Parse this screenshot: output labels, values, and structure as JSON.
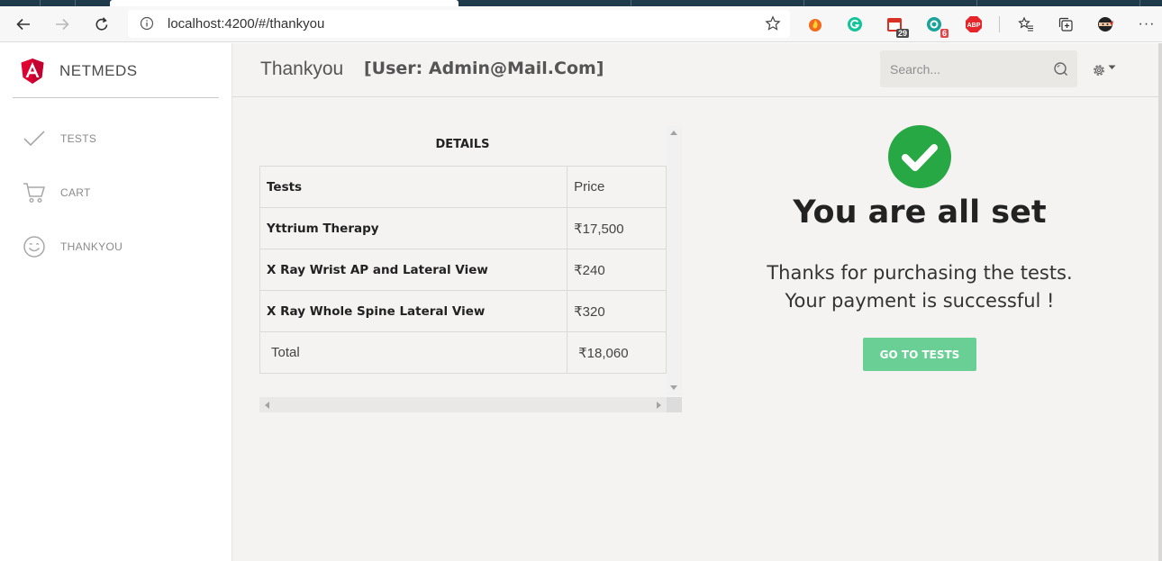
{
  "browser": {
    "url": "localhost:4200/#/thankyou",
    "extensions": [
      {
        "icon": "fire-extension-icon"
      },
      {
        "icon": "grammarly-extension-icon"
      },
      {
        "icon": "calendar-extension-icon",
        "badge": "29"
      },
      {
        "icon": "green-extension-icon",
        "badge": "6"
      },
      {
        "icon": "adblock-plus-extension-icon",
        "label": "ABP"
      },
      {
        "icon": "favorites-icon"
      },
      {
        "icon": "collections-icon"
      },
      {
        "icon": "ninja-extension-icon"
      },
      {
        "icon": "more-options-icon",
        "label": "···"
      }
    ]
  },
  "sidebar": {
    "brand": "NETMEDS",
    "items": [
      {
        "label": "TESTS",
        "icon": "check-icon"
      },
      {
        "label": "CART",
        "icon": "cart-icon"
      },
      {
        "label": "THANKYOU",
        "icon": "smiley-icon"
      }
    ]
  },
  "header": {
    "title": "Thankyou",
    "user": "[User: Admin@Mail.Com]",
    "search_placeholder": "Search...",
    "settings_icon": "gear-icon"
  },
  "details": {
    "title": "DETAILS",
    "col_tests": "Tests",
    "col_price": "Price",
    "rows": [
      {
        "name": "Yttrium Therapy",
        "price": "₹17,500"
      },
      {
        "name": "X Ray Wrist AP and Lateral View",
        "price": "₹240"
      },
      {
        "name": "X Ray Whole Spine Lateral View",
        "price": "₹320"
      }
    ],
    "total_label": "Total",
    "total_value": "₹18,060"
  },
  "success": {
    "title": "You are all set",
    "line1": "Thanks for purchasing the tests.",
    "line2": "Your payment is successful !",
    "button": "GO TO TESTS"
  },
  "colors": {
    "accent_green": "#28a745",
    "button_green": "#6acf94",
    "angular_red": "#dd0031"
  }
}
